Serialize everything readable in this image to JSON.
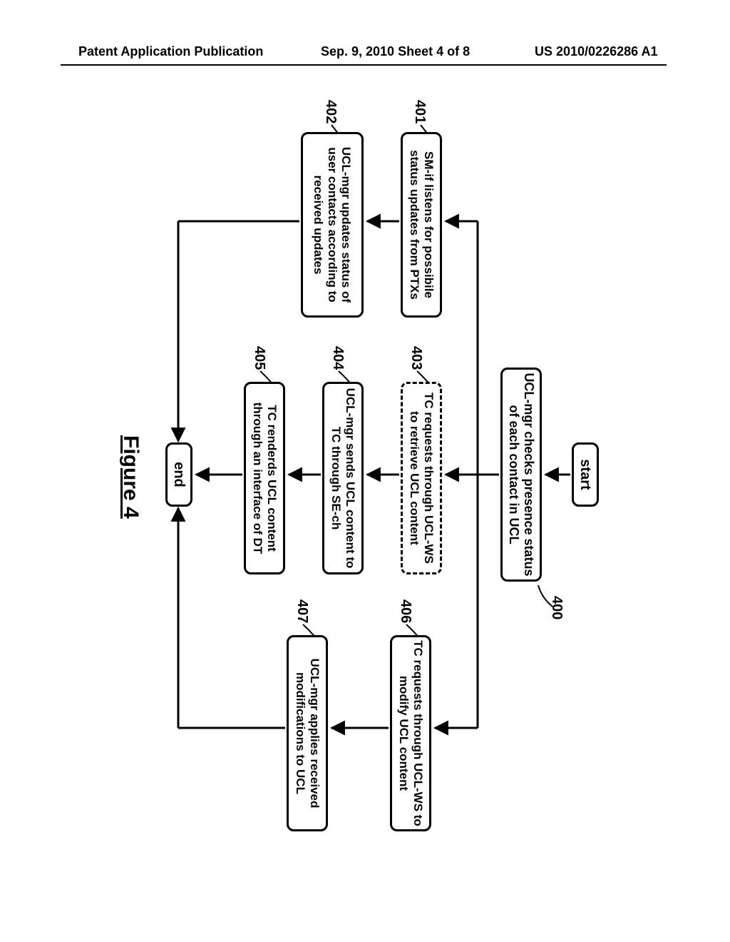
{
  "header": {
    "left": "Patent Application Publication",
    "mid": "Sep. 9, 2010  Sheet 4 of 8",
    "right": "US 2010/0226286 A1"
  },
  "figure_title": "Figure 4",
  "labels": {
    "l400": "400",
    "l401": "401",
    "l402": "402",
    "l403": "403",
    "l404": "404",
    "l405": "405",
    "l406": "406",
    "l407": "407"
  },
  "boxes": {
    "start": "start",
    "b400": "UCL-mgr checks presence status of each contact in UCL",
    "b401": "SM-if listens for possibile status updates from PTXs",
    "b402": "UCL-mgr updates status of user contacts according to received updates",
    "b403": "TC requests through UCL-WS to retrieve UCL content",
    "b404": "UCL-mgr sends UCL content to TC through SE-ch",
    "b405": "TC renderds UCL content through an interface of DT",
    "b406": "TC requests through UCL-WS to modify UCL content",
    "b407": "UCL-mgr applies received modifications to UCL",
    "end": "end"
  }
}
